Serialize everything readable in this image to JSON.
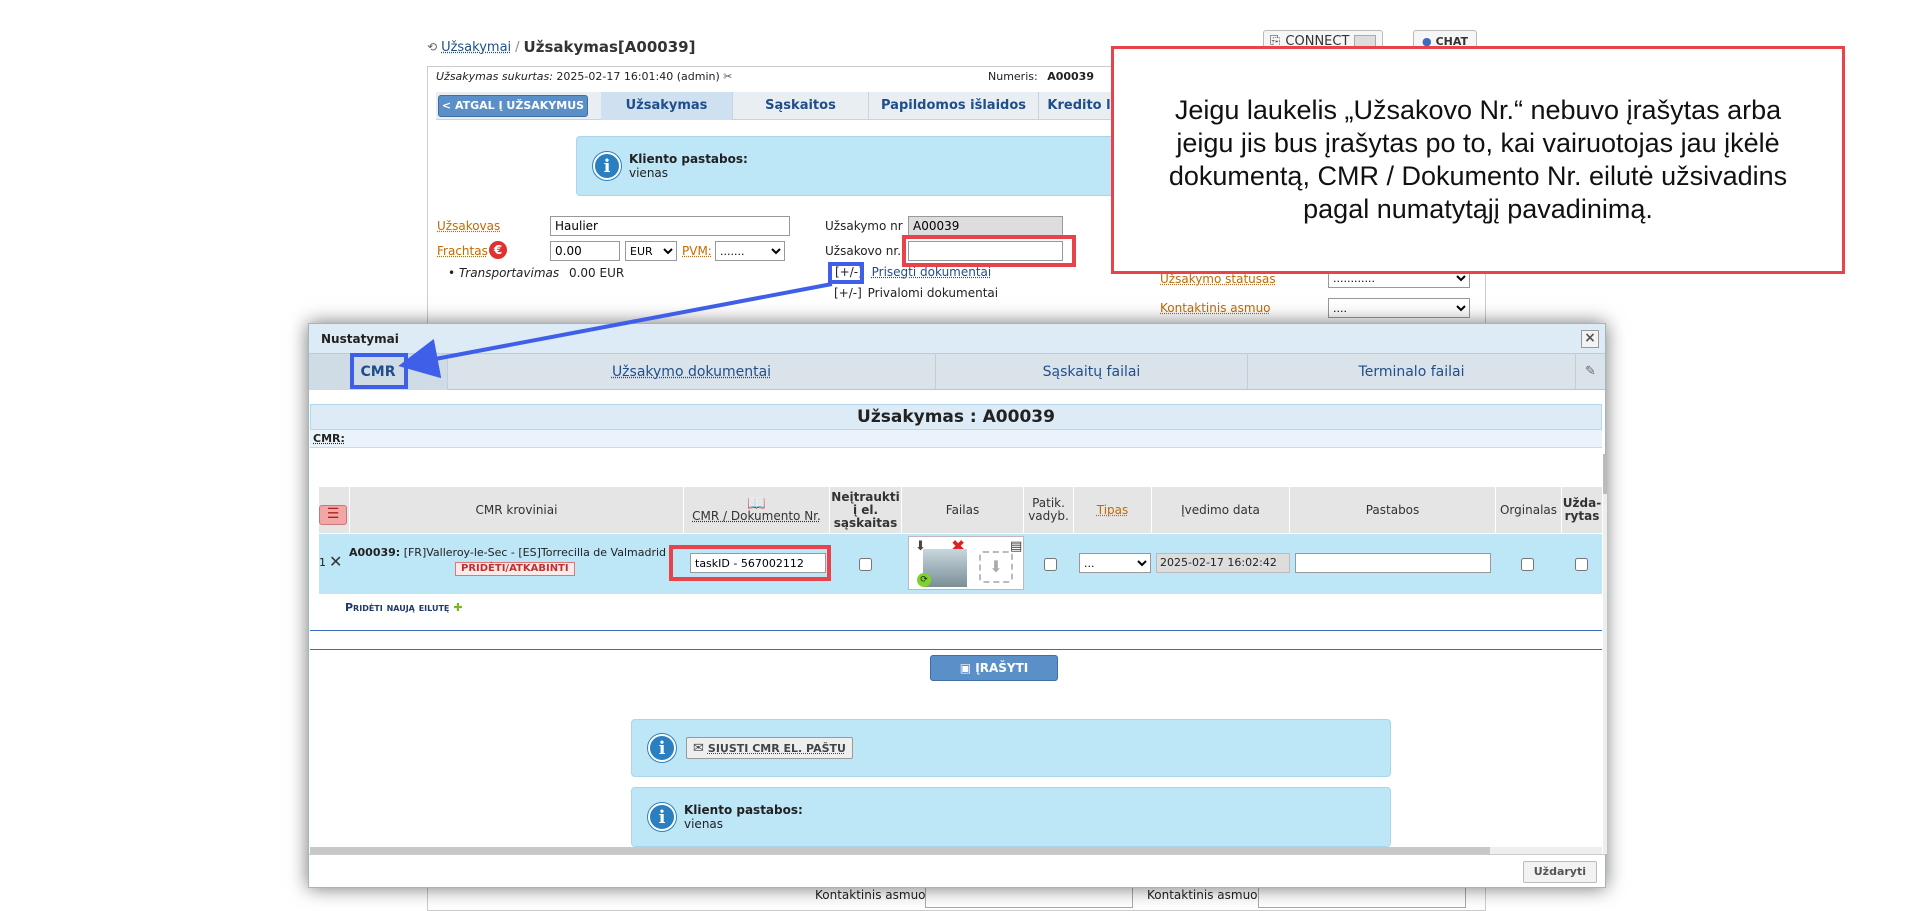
{
  "breadcrumb": {
    "root": "Užsakymai",
    "sep": "/",
    "current": "Užsakymas[A00039]"
  },
  "top_buttons": {
    "connect": "CONNECT",
    "chat": "CHAT"
  },
  "order_header": {
    "created_label": "Užsakymas sukurtas:",
    "created_value": "2025-02-17 16:01:40 (admin)",
    "number_label": "Numeris:",
    "number_value": "A00039"
  },
  "back_button": "< ATGAL Į UŽSAKYMUS",
  "tabs": [
    "Užsakymas",
    "Sąskaitos",
    "Papildomos išlaidos",
    "Kredito l"
  ],
  "client_note": {
    "title": "Kliento pastabos:",
    "text": "vienas"
  },
  "form": {
    "customer_label": "Užsakovas",
    "customer_value": "Haulier",
    "freight_label": "Frachtas",
    "freight_value": "0.00",
    "currency": "EUR",
    "vat_label": "PVM:",
    "vat_value": ".......",
    "transport_label": "Transportavimas",
    "transport_value": "0.00 EUR",
    "order_nr_label": "Užsakymo nr",
    "order_nr_value": "A00039",
    "customer_nr_label": "Užsakovo nr.",
    "customer_nr_value": "",
    "attach_toggle": "[+/-]",
    "attach_label": "Prisegti dokumentai",
    "required_toggle": "[+/-]",
    "required_label": "Privalomi dokumentai",
    "status_label": "Užsakymo statusas",
    "status_value": "............",
    "contact_label": "Kontaktinis asmuo",
    "contact_value": "...."
  },
  "callout": "Jeigu laukelis „Užsakovo Nr.“ nebuvo įrašytas arba jeigu jis bus įrašytas po to, kai vairuotojas jau įkėlė dokumentą, CMR / Dokumento Nr. eilutė užsivadins pagal numatytąjį pavadinimą.",
  "dialog": {
    "title": "Nustatymai",
    "close": "×",
    "tabs": [
      "CMR",
      "Užsakymo dokumentai",
      "Sąskaitų failai",
      "Terminalo failai"
    ],
    "heading": "Užsakymas : A00039",
    "cmr_label": "CMR:",
    "columns": [
      "CMR kroviniai",
      "CMR / Dokumento Nr.",
      "Neįtraukti į el. sąskaitas",
      "Failas",
      "Patik. vadyb.",
      "Tipas",
      "Įvedimo data",
      "Pastabos",
      "Orginalas",
      "Užda-rytas"
    ],
    "row": {
      "index": "1",
      "cargo_code": "A00039:",
      "cargo_route": "[FR]Valleroy-le-Sec - [ES]Torrecilla de Valmadrid",
      "attach_button": "PRIDĖTI/ATKABINTI",
      "doc_nr": "taskID - 567002112",
      "type_value": "...",
      "entry_date": "2025-02-17 16:02:42",
      "notes": ""
    },
    "add_row": "Pridėti naują eilutę",
    "save_button": "ĮRAŠYTI",
    "send_cmr_button": "SIŲSTI CMR EL. PAŠTU",
    "client_note_title": "Kliento pastabos:",
    "client_note_text": "vienas",
    "close_button": "Uždaryti"
  },
  "bottom": {
    "contact_left": "Kontaktinis asmuo",
    "contact_right": "Kontaktinis asmuo"
  },
  "colors": {
    "highlight_red": "#e8424a",
    "highlight_blue": "#3f5fe8",
    "info_bg": "#bde6f7"
  }
}
